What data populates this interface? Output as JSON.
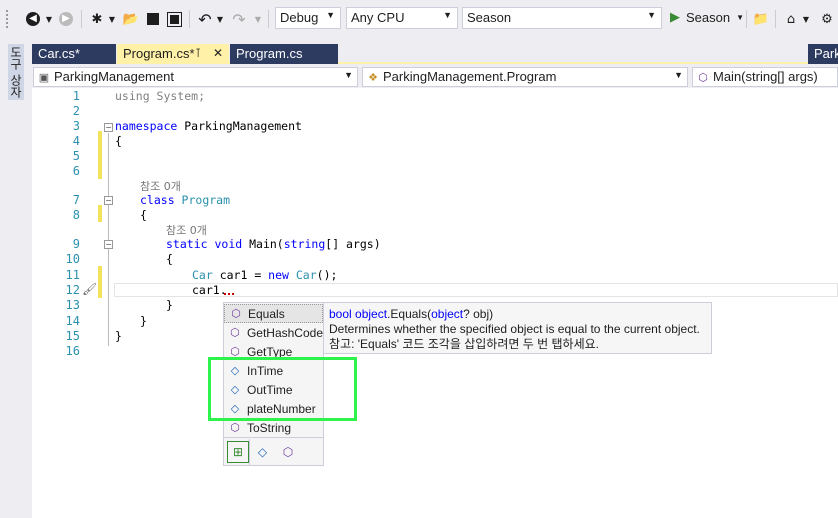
{
  "toolbar": {
    "config": "Debug",
    "platform": "Any CPU",
    "project": "Season",
    "run_label": "Season",
    "icons": [
      "back-icon",
      "forward-icon",
      "new-project-icon",
      "open-icon",
      "save-icon",
      "save-all-icon",
      "undo-icon",
      "redo-icon",
      "play-icon",
      "find-in-files-icon",
      "home-icon"
    ]
  },
  "sidetab": {
    "label": "도구 상자"
  },
  "tabs": [
    {
      "label": "Car.cs*",
      "active": false
    },
    {
      "label": "Program.cs*",
      "active": true
    },
    {
      "label": "Program.cs",
      "active": false
    },
    {
      "label": "Park",
      "active": false
    }
  ],
  "navbar": {
    "project": "ParkingManagement",
    "class": "ParkingManagement.Program",
    "member": "Main(string[] args)"
  },
  "editor": {
    "line_numbers": [
      "1",
      "2",
      "3",
      "4",
      "5",
      "6",
      "7",
      "8",
      "9",
      "10",
      "11",
      "12",
      "13",
      "14",
      "15",
      "16"
    ],
    "refs_label": "참조 0개",
    "lines": {
      "l1": "using System;",
      "l3a": "namespace",
      "l3b": " ParkingManagement",
      "l4": "{",
      "l7a": "class",
      "l7b": " Program",
      "l8": "{",
      "l9a": "static",
      "l9b": " void",
      "l9c": " Main(",
      "l9d": "string",
      "l9e": "[] args)",
      "l10": "{",
      "l11a": "Car",
      "l11b": " car1 = ",
      "l11c": "new",
      "l11d": " Car",
      "l11e": "();",
      "l12": "car1.",
      "l13": "}",
      "l14": "}",
      "l15": "}"
    }
  },
  "completion": {
    "items": [
      {
        "label": "Equals",
        "kind": "method",
        "icon": "method-icon"
      },
      {
        "label": "GetHashCode",
        "kind": "method",
        "icon": "method-icon"
      },
      {
        "label": "GetType",
        "kind": "method",
        "icon": "method-icon"
      },
      {
        "label": "InTime",
        "kind": "field",
        "icon": "field-icon"
      },
      {
        "label": "OutTime",
        "kind": "field",
        "icon": "field-icon"
      },
      {
        "label": "plateNumber",
        "kind": "field",
        "icon": "field-icon"
      },
      {
        "label": "ToString",
        "kind": "method",
        "icon": "method-icon"
      }
    ],
    "filters": [
      "expand-filter-icon",
      "field-filter-icon",
      "method-filter-icon"
    ]
  },
  "tooltip": {
    "sig_kw": "bool",
    "sig_type": "object",
    "sig_name": ".Equals(",
    "sig_param_type": "object",
    "sig_rest": "? obj)",
    "description": "Determines whether the specified object is equal to the current object.",
    "note": "참고: 'Equals' 코드 조각을 삽입하려면 두 번 탭하세요."
  }
}
